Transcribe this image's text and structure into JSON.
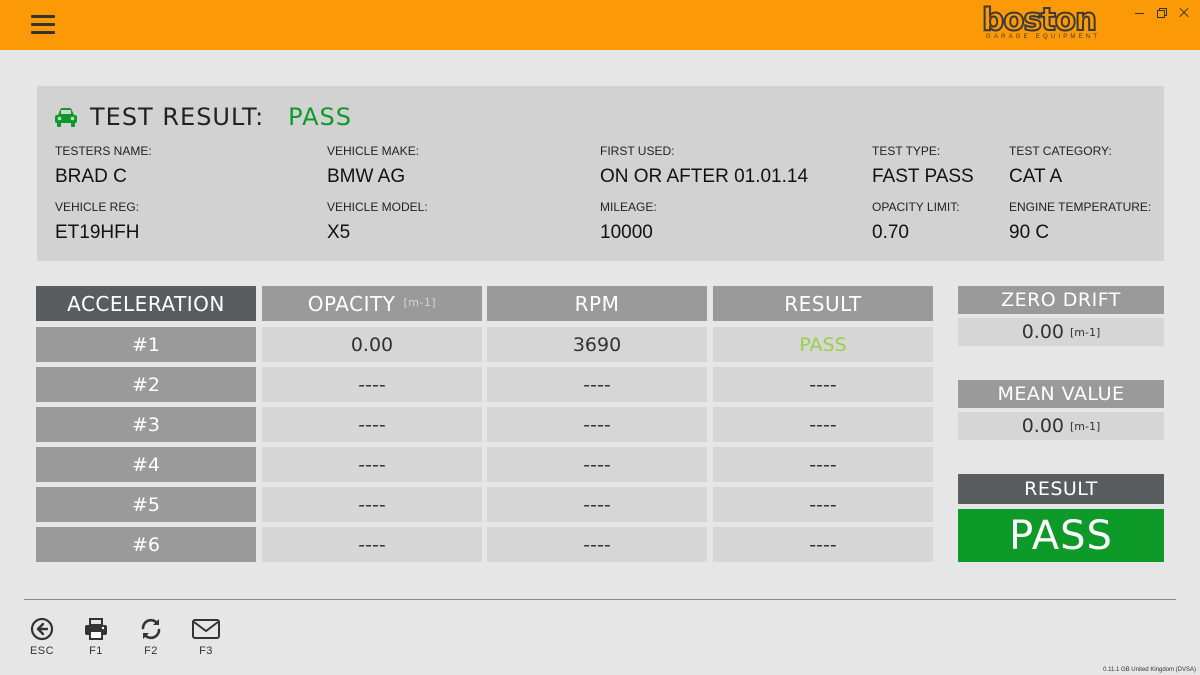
{
  "header": {
    "logo_text": "boston",
    "logo_subtitle": "GARAGE EQUIPMENT",
    "accent_color": "#fb9a06"
  },
  "test_result": {
    "title": "TEST RESULT:",
    "status": "PASS",
    "status_color": "#0d9a28",
    "icon": "car-icon"
  },
  "fields": {
    "testers_name": {
      "label": "TESTERS NAME:",
      "value": "BRAD C"
    },
    "vehicle_make": {
      "label": "VEHICLE MAKE:",
      "value": "BMW AG"
    },
    "first_used": {
      "label": "FIRST USED:",
      "value": "ON OR AFTER 01.01.14"
    },
    "test_type": {
      "label": "TEST TYPE:",
      "value": "FAST PASS"
    },
    "test_category": {
      "label": "TEST CATEGORY:",
      "value": "CAT A"
    },
    "vehicle_reg": {
      "label": "VEHICLE REG:",
      "value": "ET19HFH"
    },
    "vehicle_model": {
      "label": "VEHICLE MODEL:",
      "value": "X5"
    },
    "mileage": {
      "label": "MILEAGE:",
      "value": "10000"
    },
    "opacity_limit": {
      "label": "OPACITY LIMIT:",
      "value": "0.70"
    },
    "engine_temperature": {
      "label": "ENGINE TEMPERATURE:",
      "value": "90 C"
    }
  },
  "table": {
    "headers": {
      "acceleration": "ACCELERATION",
      "opacity": "OPACITY",
      "opacity_unit": "[m-1]",
      "rpm": "RPM",
      "result": "RESULT"
    },
    "rows": [
      {
        "label": "#1",
        "opacity": "0.00",
        "rpm": "3690",
        "result": "PASS"
      },
      {
        "label": "#2",
        "opacity": "----",
        "rpm": "----",
        "result": "----"
      },
      {
        "label": "#3",
        "opacity": "----",
        "rpm": "----",
        "result": "----"
      },
      {
        "label": "#4",
        "opacity": "----",
        "rpm": "----",
        "result": "----"
      },
      {
        "label": "#5",
        "opacity": "----",
        "rpm": "----",
        "result": "----"
      },
      {
        "label": "#6",
        "opacity": "----",
        "rpm": "----",
        "result": "----"
      }
    ]
  },
  "side": {
    "zero_drift_label": "ZERO DRIFT",
    "zero_drift_value": "0.00",
    "zero_drift_unit": "[m-1]",
    "mean_value_label": "MEAN VALUE",
    "mean_value_value": "0.00",
    "mean_value_unit": "[m-1]",
    "result_label": "RESULT",
    "result_value": "PASS"
  },
  "footer": {
    "buttons": [
      {
        "icon": "back-circle-icon",
        "label": "ESC"
      },
      {
        "icon": "printer-icon",
        "label": "F1"
      },
      {
        "icon": "refresh-icon",
        "label": "F2"
      },
      {
        "icon": "envelope-icon",
        "label": "F3"
      }
    ],
    "version": "0.11.1 GB United Kingdom (DVSA)"
  }
}
